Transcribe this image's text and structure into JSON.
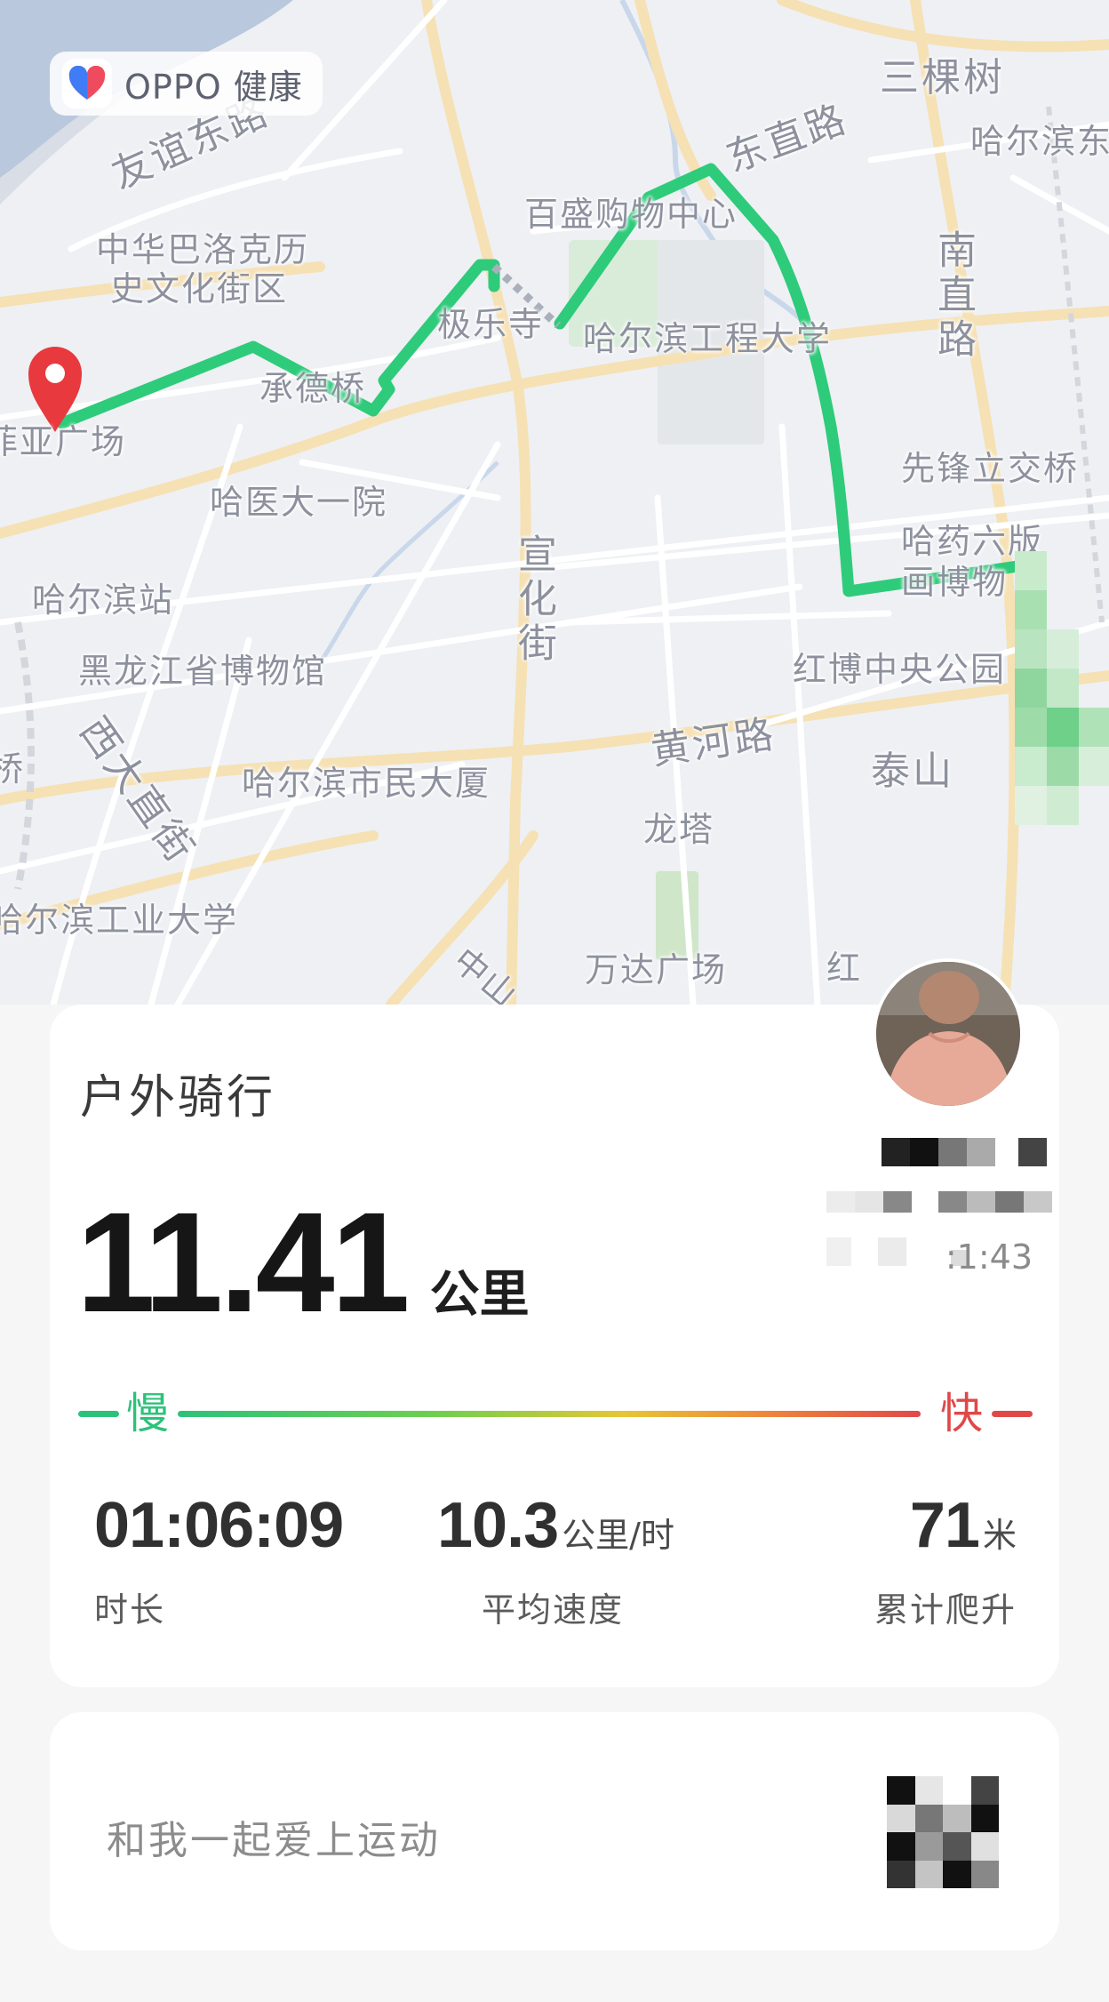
{
  "app": {
    "brand_name": "OPPO 健康",
    "brand_color": "#3f7cf5",
    "brand_accent": "#ef4b5e"
  },
  "map": {
    "labels": [
      "三棵树",
      "哈尔滨东",
      "友谊东路",
      "中华巴洛克历",
      "史文化街区",
      "百盛购物中心",
      "东直路",
      "南直路",
      "极乐寺",
      "哈尔滨工程大学",
      "承德桥",
      "菲亚广场",
      "先锋立交桥",
      "哈医大一院",
      "哈药六版",
      "画博物",
      "宣化街",
      "哈尔滨站",
      "黑龙江省博物馆",
      "红博中央公园",
      "黄河路",
      "西大直街",
      "泰山",
      "桥",
      "哈尔滨市民大厦",
      "龙塔",
      "哈尔滨工业大学",
      "中山",
      "万达广场",
      "红"
    ],
    "route_color": "#2ecb7a",
    "start_marker_color": "#e8393f"
  },
  "activity": {
    "title": "户外骑行",
    "distance": "11.41",
    "distance_unit": "公里",
    "time_tail": ":1:43",
    "speed_scale": {
      "slow": "慢",
      "fast": "快"
    },
    "metrics": [
      {
        "value": "01:06:09",
        "unit": "",
        "label": "时长"
      },
      {
        "value": "10.3",
        "unit": "公里/时",
        "label": "平均速度"
      },
      {
        "value": "71",
        "unit": "米",
        "label": "累计爬升"
      }
    ]
  },
  "share": {
    "text": "和我一起爱上运动"
  },
  "icons": {
    "brand": "heart-icon",
    "start": "location-pin-icon",
    "avatar": "user-avatar",
    "qr": "qr-code-icon"
  }
}
